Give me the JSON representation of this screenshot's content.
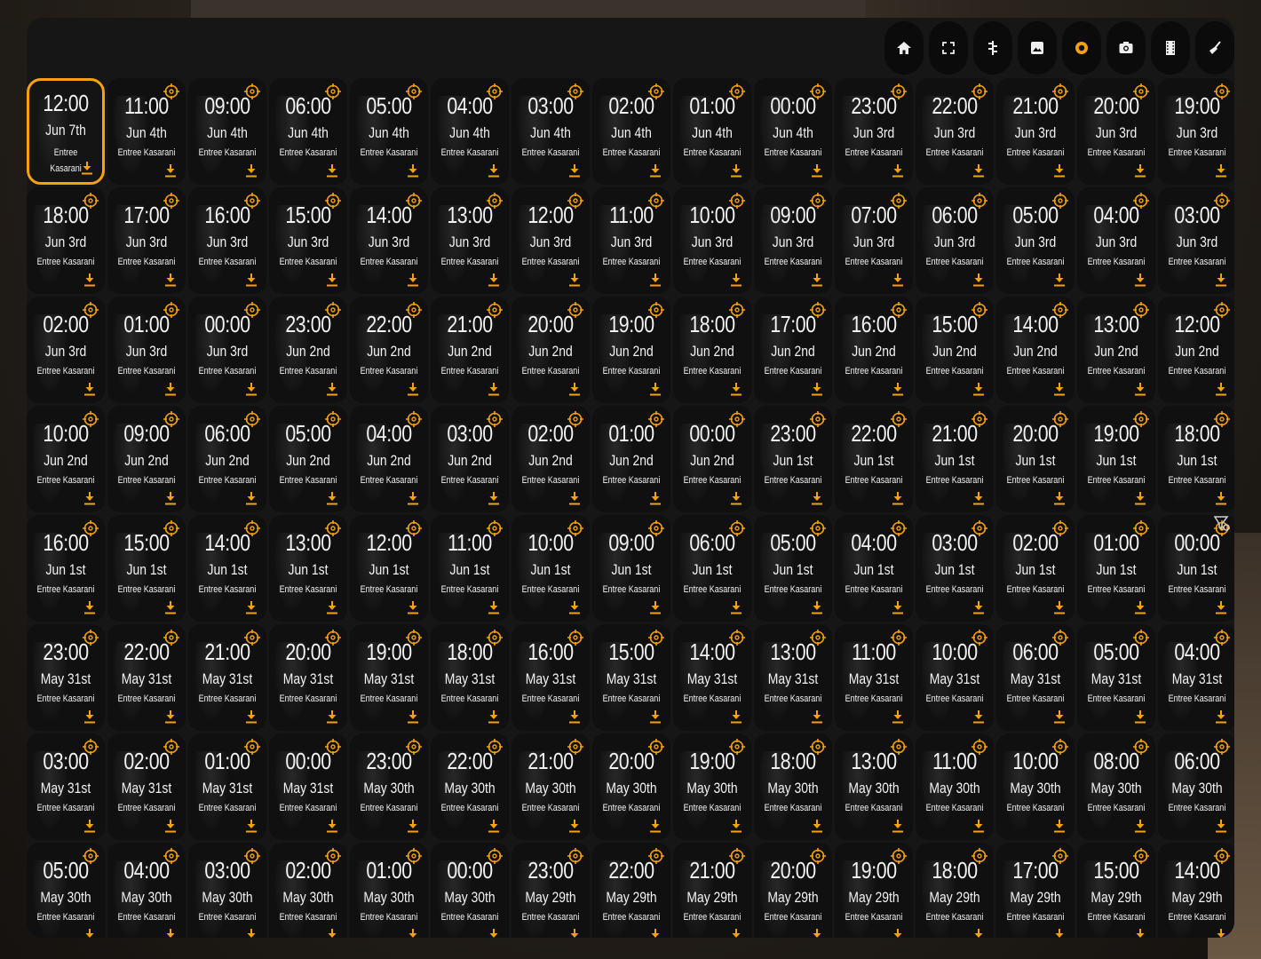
{
  "toolbar": [
    {
      "name": "home-button",
      "icon": "home-icon"
    },
    {
      "name": "fullscreen-button",
      "icon": "fullscreen-icon"
    },
    {
      "name": "timeline-button",
      "icon": "timeline-icon"
    },
    {
      "name": "image-button",
      "icon": "image-icon"
    },
    {
      "name": "record-button",
      "icon": "record-icon",
      "active": true
    },
    {
      "name": "snapshot-button",
      "icon": "camera-icon"
    },
    {
      "name": "clips-button",
      "icon": "film-icon"
    },
    {
      "name": "cleanup-button",
      "icon": "broom-icon"
    }
  ],
  "accent_color": "#f5a20c",
  "location": "Entree Kasarani",
  "clips": [
    {
      "time": "12:00",
      "date": "Jun 7th",
      "selected": true
    },
    {
      "time": "11:00",
      "date": "Jun 4th"
    },
    {
      "time": "09:00",
      "date": "Jun 4th"
    },
    {
      "time": "06:00",
      "date": "Jun 4th"
    },
    {
      "time": "05:00",
      "date": "Jun 4th"
    },
    {
      "time": "04:00",
      "date": "Jun 4th"
    },
    {
      "time": "03:00",
      "date": "Jun 4th"
    },
    {
      "time": "02:00",
      "date": "Jun 4th"
    },
    {
      "time": "01:00",
      "date": "Jun 4th"
    },
    {
      "time": "00:00",
      "date": "Jun 4th"
    },
    {
      "time": "23:00",
      "date": "Jun 3rd"
    },
    {
      "time": "22:00",
      "date": "Jun 3rd"
    },
    {
      "time": "21:00",
      "date": "Jun 3rd"
    },
    {
      "time": "20:00",
      "date": "Jun 3rd"
    },
    {
      "time": "19:00",
      "date": "Jun 3rd"
    },
    {
      "time": "18:00",
      "date": "Jun 3rd"
    },
    {
      "time": "17:00",
      "date": "Jun 3rd"
    },
    {
      "time": "16:00",
      "date": "Jun 3rd"
    },
    {
      "time": "15:00",
      "date": "Jun 3rd"
    },
    {
      "time": "14:00",
      "date": "Jun 3rd"
    },
    {
      "time": "13:00",
      "date": "Jun 3rd"
    },
    {
      "time": "12:00",
      "date": "Jun 3rd"
    },
    {
      "time": "11:00",
      "date": "Jun 3rd"
    },
    {
      "time": "10:00",
      "date": "Jun 3rd"
    },
    {
      "time": "09:00",
      "date": "Jun 3rd"
    },
    {
      "time": "07:00",
      "date": "Jun 3rd"
    },
    {
      "time": "06:00",
      "date": "Jun 3rd"
    },
    {
      "time": "05:00",
      "date": "Jun 3rd"
    },
    {
      "time": "04:00",
      "date": "Jun 3rd"
    },
    {
      "time": "03:00",
      "date": "Jun 3rd"
    },
    {
      "time": "02:00",
      "date": "Jun 3rd"
    },
    {
      "time": "01:00",
      "date": "Jun 3rd"
    },
    {
      "time": "00:00",
      "date": "Jun 3rd"
    },
    {
      "time": "23:00",
      "date": "Jun 2nd"
    },
    {
      "time": "22:00",
      "date": "Jun 2nd"
    },
    {
      "time": "21:00",
      "date": "Jun 2nd"
    },
    {
      "time": "20:00",
      "date": "Jun 2nd"
    },
    {
      "time": "19:00",
      "date": "Jun 2nd"
    },
    {
      "time": "18:00",
      "date": "Jun 2nd"
    },
    {
      "time": "17:00",
      "date": "Jun 2nd"
    },
    {
      "time": "16:00",
      "date": "Jun 2nd"
    },
    {
      "time": "15:00",
      "date": "Jun 2nd"
    },
    {
      "time": "14:00",
      "date": "Jun 2nd"
    },
    {
      "time": "13:00",
      "date": "Jun 2nd"
    },
    {
      "time": "12:00",
      "date": "Jun 2nd"
    },
    {
      "time": "10:00",
      "date": "Jun 2nd"
    },
    {
      "time": "09:00",
      "date": "Jun 2nd"
    },
    {
      "time": "06:00",
      "date": "Jun 2nd"
    },
    {
      "time": "05:00",
      "date": "Jun 2nd"
    },
    {
      "time": "04:00",
      "date": "Jun 2nd"
    },
    {
      "time": "03:00",
      "date": "Jun 2nd"
    },
    {
      "time": "02:00",
      "date": "Jun 2nd"
    },
    {
      "time": "01:00",
      "date": "Jun 2nd"
    },
    {
      "time": "00:00",
      "date": "Jun 2nd"
    },
    {
      "time": "23:00",
      "date": "Jun 1st"
    },
    {
      "time": "22:00",
      "date": "Jun 1st"
    },
    {
      "time": "21:00",
      "date": "Jun 1st"
    },
    {
      "time": "20:00",
      "date": "Jun 1st"
    },
    {
      "time": "19:00",
      "date": "Jun 1st"
    },
    {
      "time": "18:00",
      "date": "Jun 1st"
    },
    {
      "time": "16:00",
      "date": "Jun 1st"
    },
    {
      "time": "15:00",
      "date": "Jun 1st"
    },
    {
      "time": "14:00",
      "date": "Jun 1st"
    },
    {
      "time": "13:00",
      "date": "Jun 1st"
    },
    {
      "time": "12:00",
      "date": "Jun 1st"
    },
    {
      "time": "11:00",
      "date": "Jun 1st"
    },
    {
      "time": "10:00",
      "date": "Jun 1st"
    },
    {
      "time": "09:00",
      "date": "Jun 1st"
    },
    {
      "time": "06:00",
      "date": "Jun 1st"
    },
    {
      "time": "05:00",
      "date": "Jun 1st"
    },
    {
      "time": "04:00",
      "date": "Jun 1st"
    },
    {
      "time": "03:00",
      "date": "Jun 1st"
    },
    {
      "time": "02:00",
      "date": "Jun 1st"
    },
    {
      "time": "01:00",
      "date": "Jun 1st"
    },
    {
      "time": "00:00",
      "date": "Jun 1st"
    },
    {
      "time": "23:00",
      "date": "May 31st"
    },
    {
      "time": "22:00",
      "date": "May 31st"
    },
    {
      "time": "21:00",
      "date": "May 31st"
    },
    {
      "time": "20:00",
      "date": "May 31st"
    },
    {
      "time": "19:00",
      "date": "May 31st"
    },
    {
      "time": "18:00",
      "date": "May 31st"
    },
    {
      "time": "16:00",
      "date": "May 31st"
    },
    {
      "time": "15:00",
      "date": "May 31st"
    },
    {
      "time": "14:00",
      "date": "May 31st"
    },
    {
      "time": "13:00",
      "date": "May 31st"
    },
    {
      "time": "11:00",
      "date": "May 31st"
    },
    {
      "time": "10:00",
      "date": "May 31st"
    },
    {
      "time": "06:00",
      "date": "May 31st"
    },
    {
      "time": "05:00",
      "date": "May 31st"
    },
    {
      "time": "04:00",
      "date": "May 31st"
    },
    {
      "time": "03:00",
      "date": "May 31st"
    },
    {
      "time": "02:00",
      "date": "May 31st"
    },
    {
      "time": "01:00",
      "date": "May 31st"
    },
    {
      "time": "00:00",
      "date": "May 31st"
    },
    {
      "time": "23:00",
      "date": "May 30th"
    },
    {
      "time": "22:00",
      "date": "May 30th"
    },
    {
      "time": "21:00",
      "date": "May 30th"
    },
    {
      "time": "20:00",
      "date": "May 30th"
    },
    {
      "time": "19:00",
      "date": "May 30th"
    },
    {
      "time": "18:00",
      "date": "May 30th"
    },
    {
      "time": "13:00",
      "date": "May 30th"
    },
    {
      "time": "11:00",
      "date": "May 30th"
    },
    {
      "time": "10:00",
      "date": "May 30th"
    },
    {
      "time": "08:00",
      "date": "May 30th"
    },
    {
      "time": "06:00",
      "date": "May 30th"
    },
    {
      "time": "05:00",
      "date": "May 30th"
    },
    {
      "time": "04:00",
      "date": "May 30th"
    },
    {
      "time": "03:00",
      "date": "May 30th"
    },
    {
      "time": "02:00",
      "date": "May 30th"
    },
    {
      "time": "01:00",
      "date": "May 30th"
    },
    {
      "time": "00:00",
      "date": "May 30th"
    },
    {
      "time": "23:00",
      "date": "May 29th"
    },
    {
      "time": "22:00",
      "date": "May 29th"
    },
    {
      "time": "21:00",
      "date": "May 29th"
    },
    {
      "time": "20:00",
      "date": "May 29th"
    },
    {
      "time": "19:00",
      "date": "May 29th"
    },
    {
      "time": "18:00",
      "date": "May 29th"
    },
    {
      "time": "17:00",
      "date": "May 29th"
    },
    {
      "time": "15:00",
      "date": "May 29th"
    },
    {
      "time": "14:00",
      "date": "May 29th"
    }
  ]
}
